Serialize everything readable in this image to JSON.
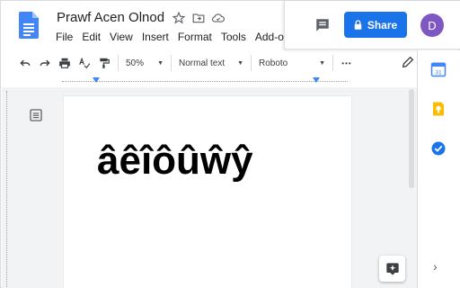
{
  "document": {
    "title": "Prawf Acen Olnod",
    "body_text": "âêîôûŵŷ"
  },
  "menu": [
    "File",
    "Edit",
    "View",
    "Insert",
    "Format",
    "Tools",
    "Add-ons"
  ],
  "header": {
    "share_label": "Share",
    "avatar_letter": "D"
  },
  "toolbar": {
    "zoom": "50%",
    "style": "Normal text",
    "font": "Roboto",
    "more": "•••"
  },
  "colors": {
    "accent": "#1a73e8",
    "avatar": "#7e57c2",
    "docs_blue": "#4285f4",
    "keep_yellow": "#fbbc04",
    "tasks_blue": "#1a73e8"
  },
  "icons": {
    "star": "star-icon",
    "move": "folder-move-icon",
    "cloud": "cloud-status-icon",
    "comment": "comment-icon",
    "lock": "lock-icon",
    "undo": "undo-icon",
    "redo": "redo-icon",
    "print": "print-icon",
    "spell": "spellcheck-icon",
    "paint": "paint-format-icon",
    "pencil": "editing-mode-icon",
    "outline": "outline-icon",
    "explore": "explore-icon",
    "calendar": "calendar-icon",
    "keep": "keep-icon",
    "tasks": "tasks-icon",
    "chevron": "chevron-right-icon"
  }
}
